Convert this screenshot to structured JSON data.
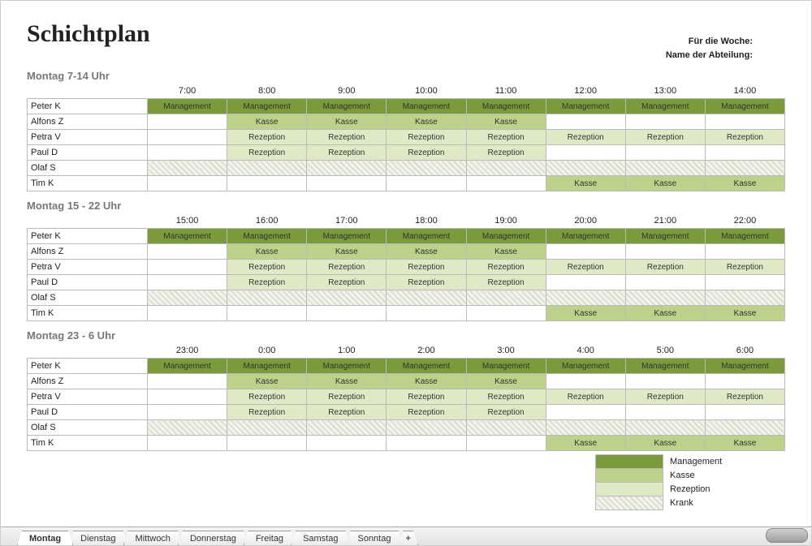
{
  "title": "Schichtplan",
  "meta": {
    "week_label": "Für die Woche:",
    "dept_label": "Name der Abteilung:"
  },
  "employees": [
    "Peter K",
    "Alfons Z",
    "Petra V",
    "Paul D",
    "Olaf S",
    "Tim K"
  ],
  "classMap": {
    "Management": "c-mgmt",
    "Kasse": "c-kasse",
    "Rezeption": "c-recep",
    "Krank": "c-sick",
    "": "c-empty"
  },
  "blocks": [
    {
      "title": "Montag 7-14 Uhr",
      "hours": [
        "7:00",
        "8:00",
        "9:00",
        "10:00",
        "11:00",
        "12:00",
        "13:00",
        "14:00"
      ],
      "rows": [
        [
          "Management",
          "Management",
          "Management",
          "Management",
          "Management",
          "Management",
          "Management",
          "Management"
        ],
        [
          "",
          "Kasse",
          "Kasse",
          "Kasse",
          "Kasse",
          "",
          "",
          ""
        ],
        [
          "",
          "Rezeption",
          "Rezeption",
          "Rezeption",
          "Rezeption",
          "Rezeption",
          "Rezeption",
          "Rezeption"
        ],
        [
          "",
          "Rezeption",
          "Rezeption",
          "Rezeption",
          "Rezeption",
          "",
          "",
          ""
        ],
        [
          "Krank",
          "Krank",
          "Krank",
          "Krank",
          "Krank",
          "Krank",
          "Krank",
          "Krank"
        ],
        [
          "",
          "",
          "",
          "",
          "",
          "Kasse",
          "Kasse",
          "Kasse"
        ]
      ]
    },
    {
      "title": "Montag 15 - 22 Uhr",
      "hours": [
        "15:00",
        "16:00",
        "17:00",
        "18:00",
        "19:00",
        "20:00",
        "21:00",
        "22:00"
      ],
      "rows": [
        [
          "Management",
          "Management",
          "Management",
          "Management",
          "Management",
          "Management",
          "Management",
          "Management"
        ],
        [
          "",
          "Kasse",
          "Kasse",
          "Kasse",
          "Kasse",
          "",
          "",
          ""
        ],
        [
          "",
          "Rezeption",
          "Rezeption",
          "Rezeption",
          "Rezeption",
          "Rezeption",
          "Rezeption",
          "Rezeption"
        ],
        [
          "",
          "Rezeption",
          "Rezeption",
          "Rezeption",
          "Rezeption",
          "",
          "",
          ""
        ],
        [
          "Krank",
          "Krank",
          "Krank",
          "Krank",
          "Krank",
          "Krank",
          "Krank",
          "Krank"
        ],
        [
          "",
          "",
          "",
          "",
          "",
          "Kasse",
          "Kasse",
          "Kasse"
        ]
      ]
    },
    {
      "title": "Montag 23 - 6 Uhr",
      "hours": [
        "23:00",
        "0:00",
        "1:00",
        "2:00",
        "3:00",
        "4:00",
        "5:00",
        "6:00"
      ],
      "rows": [
        [
          "Management",
          "Management",
          "Management",
          "Management",
          "Management",
          "Management",
          "Management",
          "Management"
        ],
        [
          "",
          "Kasse",
          "Kasse",
          "Kasse",
          "Kasse",
          "",
          "",
          ""
        ],
        [
          "",
          "Rezeption",
          "Rezeption",
          "Rezeption",
          "Rezeption",
          "Rezeption",
          "Rezeption",
          "Rezeption"
        ],
        [
          "",
          "Rezeption",
          "Rezeption",
          "Rezeption",
          "Rezeption",
          "",
          "",
          ""
        ],
        [
          "Krank",
          "Krank",
          "Krank",
          "Krank",
          "Krank",
          "Krank",
          "Krank",
          "Krank"
        ],
        [
          "",
          "",
          "",
          "",
          "",
          "Kasse",
          "Kasse",
          "Kasse"
        ]
      ]
    }
  ],
  "legend": [
    {
      "label": "Management",
      "cls": "c-mgmt"
    },
    {
      "label": "Kasse",
      "cls": "c-kasse"
    },
    {
      "label": "Rezeption",
      "cls": "c-recep"
    },
    {
      "label": "Krank",
      "cls": "c-sick"
    }
  ],
  "tabs": [
    "Montag",
    "Dienstag",
    "Mittwoch",
    "Donnerstag",
    "Freitag",
    "Samstag",
    "Sonntag"
  ],
  "active_tab": "Montag",
  "add_tab": "+"
}
